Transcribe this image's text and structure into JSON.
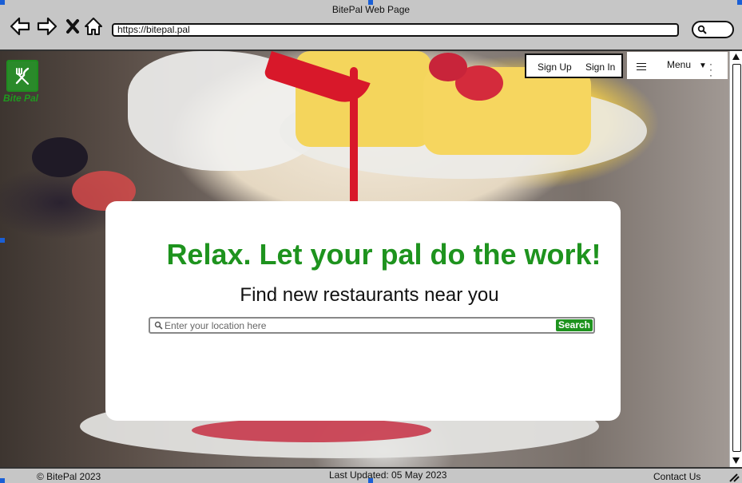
{
  "window": {
    "title": "BitePal Web Page",
    "url": "https://bitepal.pal"
  },
  "icons": {
    "back": "back-arrow-icon",
    "forward": "forward-arrow-icon",
    "stop": "close-x-icon",
    "home": "home-icon",
    "search": "search-icon",
    "logo": "fork-knife-icon",
    "menu": "hamburger-icon"
  },
  "brand": {
    "name": "Bite Pal",
    "color": "#1e931e"
  },
  "header": {
    "sign_up": "Sign Up",
    "sign_in": "Sign In",
    "menu_label": "Menu"
  },
  "hero": {
    "headline": "Relax. Let your pal do the work!",
    "subheadline": "Find new restaurants near you",
    "search_placeholder": "Enter your location here",
    "search_button": "Search"
  },
  "footer": {
    "copyright": "© BitePal 2023",
    "last_updated": "Last Updated: 05 May 2023",
    "contact": "Contact Us"
  }
}
